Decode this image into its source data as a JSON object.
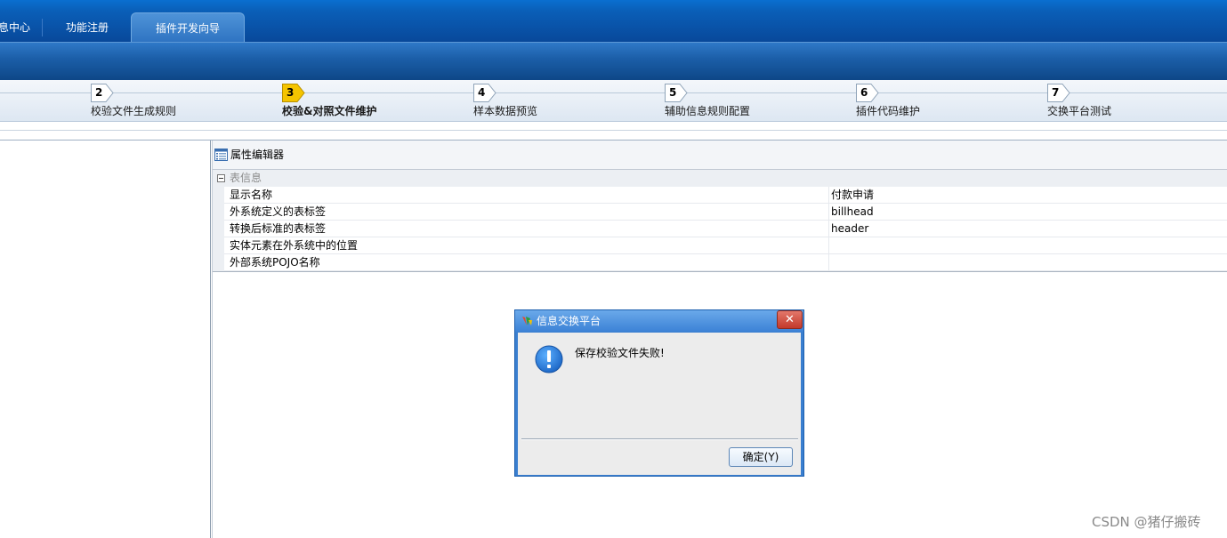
{
  "colors": {
    "header_blue": "#08489a",
    "active_step": "#f5c400",
    "dialog_blue": "#3a7fd0",
    "warning_icon": "#1a78d8"
  },
  "top_tabs": [
    {
      "label": "息中心"
    },
    {
      "label": "功能注册"
    },
    {
      "label": "插件开发向导",
      "selected": true
    }
  ],
  "wizard": {
    "steps": [
      {
        "num": "2",
        "label": "校验文件生成规则"
      },
      {
        "num": "3",
        "label": "校验&对照文件维护",
        "active": true
      },
      {
        "num": "4",
        "label": "样本数据预览"
      },
      {
        "num": "5",
        "label": "辅助信息规则配置"
      },
      {
        "num": "6",
        "label": "插件代码维护"
      },
      {
        "num": "7",
        "label": "交换平台测试"
      }
    ]
  },
  "property_editor": {
    "title": "属性编辑器",
    "icon": "property-list-icon",
    "group": {
      "title": "表信息",
      "expanded": true
    },
    "rows": [
      {
        "name": "显示名称",
        "value": "付款申请"
      },
      {
        "name": "外系统定义的表标签",
        "value": "billhead"
      },
      {
        "name": "转换后标准的表标签",
        "value": "header"
      },
      {
        "name": "实体元素在外系统中的位置",
        "value": ""
      },
      {
        "name": "外部系统POJO名称",
        "value": ""
      }
    ]
  },
  "dialog": {
    "title": "信息交换平台",
    "message": "保存校验文件失败!",
    "icon": "exclamation-icon",
    "ok_label": "确定(Y)",
    "close_label": "✕"
  },
  "watermark": "CSDN @猪仔搬砖"
}
